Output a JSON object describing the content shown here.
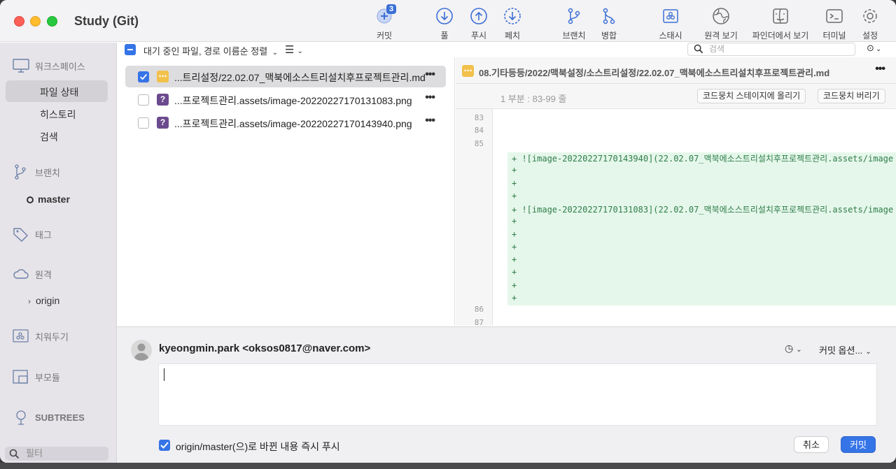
{
  "window": {
    "title": "Study (Git)"
  },
  "toolbar": {
    "commit": {
      "label": "커밋",
      "badge": "3"
    },
    "pull": {
      "label": "풀"
    },
    "push": {
      "label": "푸시"
    },
    "fetch": {
      "label": "페치"
    },
    "branch": {
      "label": "브랜치"
    },
    "merge": {
      "label": "병합"
    },
    "stash": {
      "label": "스태시"
    },
    "remote": {
      "label": "원격 보기"
    },
    "finder": {
      "label": "파인더에서 보기"
    },
    "terminal": {
      "label": "터미널"
    },
    "settings": {
      "label": "설정"
    }
  },
  "sidebar": {
    "workspace": "워크스페이스",
    "workspace_items": [
      "파일 상태",
      "히스토리",
      "검색"
    ],
    "branches": "브랜치",
    "branch_current": "master",
    "tags": "태그",
    "remotes": "원격",
    "remote_origin": "origin",
    "stashes": "치워두기",
    "submodules": "부모듈",
    "subtrees": "SUBTREES",
    "filter_placeholder": "필터"
  },
  "filelist": {
    "sort_label": "대기 중인 파일, 경로 이름순 정렬",
    "search_placeholder": "검색",
    "files": [
      {
        "name": "...트리설정/22.02.07_맥북에소스트리설치후프로젝트관리.md",
        "status": "modified",
        "checked": true
      },
      {
        "name": "...프로젝트관리.assets/image-20220227170131083.png",
        "status": "untracked",
        "checked": false
      },
      {
        "name": "...프로젝트관리.assets/image-20220227170143940.png",
        "status": "untracked",
        "checked": false
      }
    ]
  },
  "diff": {
    "path": "08.기타등등/2022/맥북설정/소스트리설정/22.02.07_맥북에소스트리설치후프로젝트관리.md",
    "hunk_label": "1 부분 : 83-99 줄",
    "stage_hunk": "코드뭉치 스테이지에 올리기",
    "discard_hunk": "코드뭉치 버리기",
    "line_numbers_top": [
      "83",
      "84",
      "85"
    ],
    "line_numbers_bottom": [
      "86",
      "87"
    ],
    "added_lines": [
      "+ ![image-20220227170143940](22.02.07_맥북에소스트리설치후프로젝트관리.assets/image",
      "+",
      "+",
      "+",
      "+ ![image-20220227170131083](22.02.07_맥북에소스트리설치후프로젝트관리.assets/image",
      "+",
      "+",
      "+",
      "+",
      "+",
      "+",
      "+"
    ]
  },
  "commit": {
    "author": "kyeongmin.park <oksos0817@naver.com>",
    "options": "커밋 옵션...",
    "push_immediately": "origin/master(으)로 바뀐 내용 즉시 푸시",
    "cancel": "취소",
    "commit": "커밋"
  },
  "colors": {
    "accent": "#3574e7",
    "added_bg": "#e5f7ea",
    "modified": "#f2c14c",
    "untracked": "#6c4a8e"
  }
}
